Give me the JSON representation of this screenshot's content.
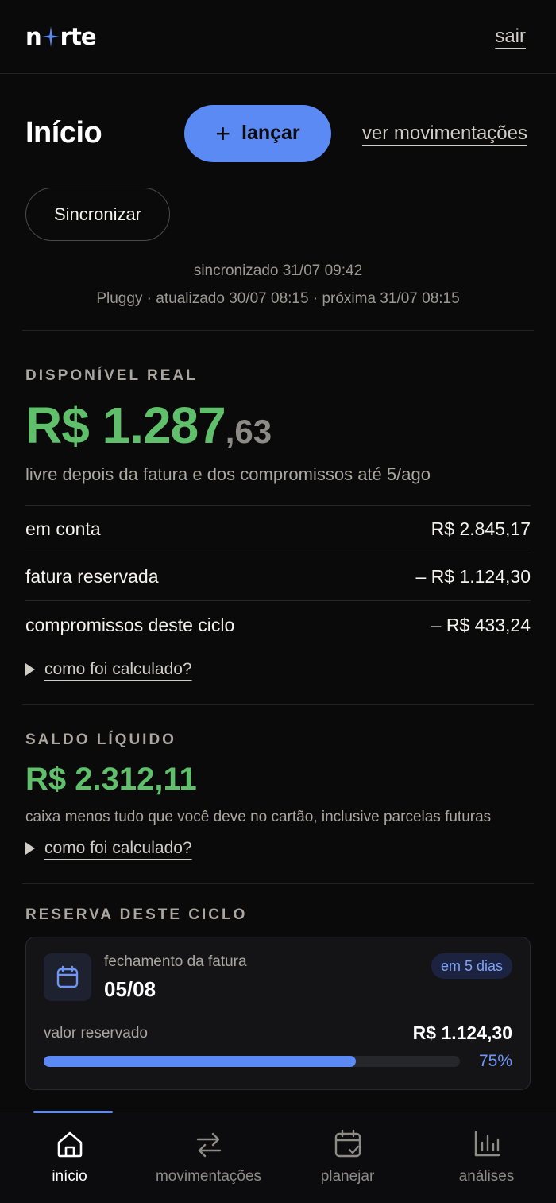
{
  "brand": {
    "logo_left": "n",
    "logo_right": "rte",
    "logout": "sair"
  },
  "header": {
    "title": "Início",
    "launch_label": "lançar",
    "movements_link": "ver movimentações"
  },
  "sync": {
    "button": "Sincronizar",
    "line1": "sincronizado 31/07 09:42",
    "line2": "Pluggy · atualizado 30/07 08:15 · próxima 31/07 08:15"
  },
  "available": {
    "eyebrow": "DISPONÍVEL REAL",
    "amount_main": "R$ 1.287",
    "amount_cents": ",63",
    "subtitle": "livre depois da fatura e dos compromissos até 5/ago",
    "rows": [
      {
        "label": "em conta",
        "value": "R$ 2.845,17"
      },
      {
        "label": "fatura reservada",
        "value": "– R$ 1.124,30"
      },
      {
        "label": "compromissos deste ciclo",
        "value": "– R$ 433,24"
      }
    ],
    "how": "como foi calculado?"
  },
  "net": {
    "eyebrow": "SALDO LÍQUIDO",
    "amount": "R$ 2.312,11",
    "subtitle": "caixa menos tudo que você deve no cartão, inclusive parcelas futuras",
    "how": "como foi calculado?"
  },
  "reserve": {
    "eyebrow": "RESERVA DESTE CICLO",
    "closing_label": "fechamento da fatura",
    "closing_date": "05/08",
    "badge": "em 5 dias",
    "reserved_label": "valor reservado",
    "reserved_value": "R$ 1.124,30",
    "progress_pct": 75,
    "progress_label": "75%"
  },
  "nav": {
    "items": [
      {
        "label": "início",
        "icon": "home-icon"
      },
      {
        "label": "movimentações",
        "icon": "arrows-icon"
      },
      {
        "label": "planejar",
        "icon": "calendar-check-icon"
      },
      {
        "label": "análises",
        "icon": "bar-chart-icon"
      }
    ]
  },
  "colors": {
    "accent": "#5b8af5",
    "positive": "#5fbf6a",
    "background": "#0a0a0b"
  }
}
